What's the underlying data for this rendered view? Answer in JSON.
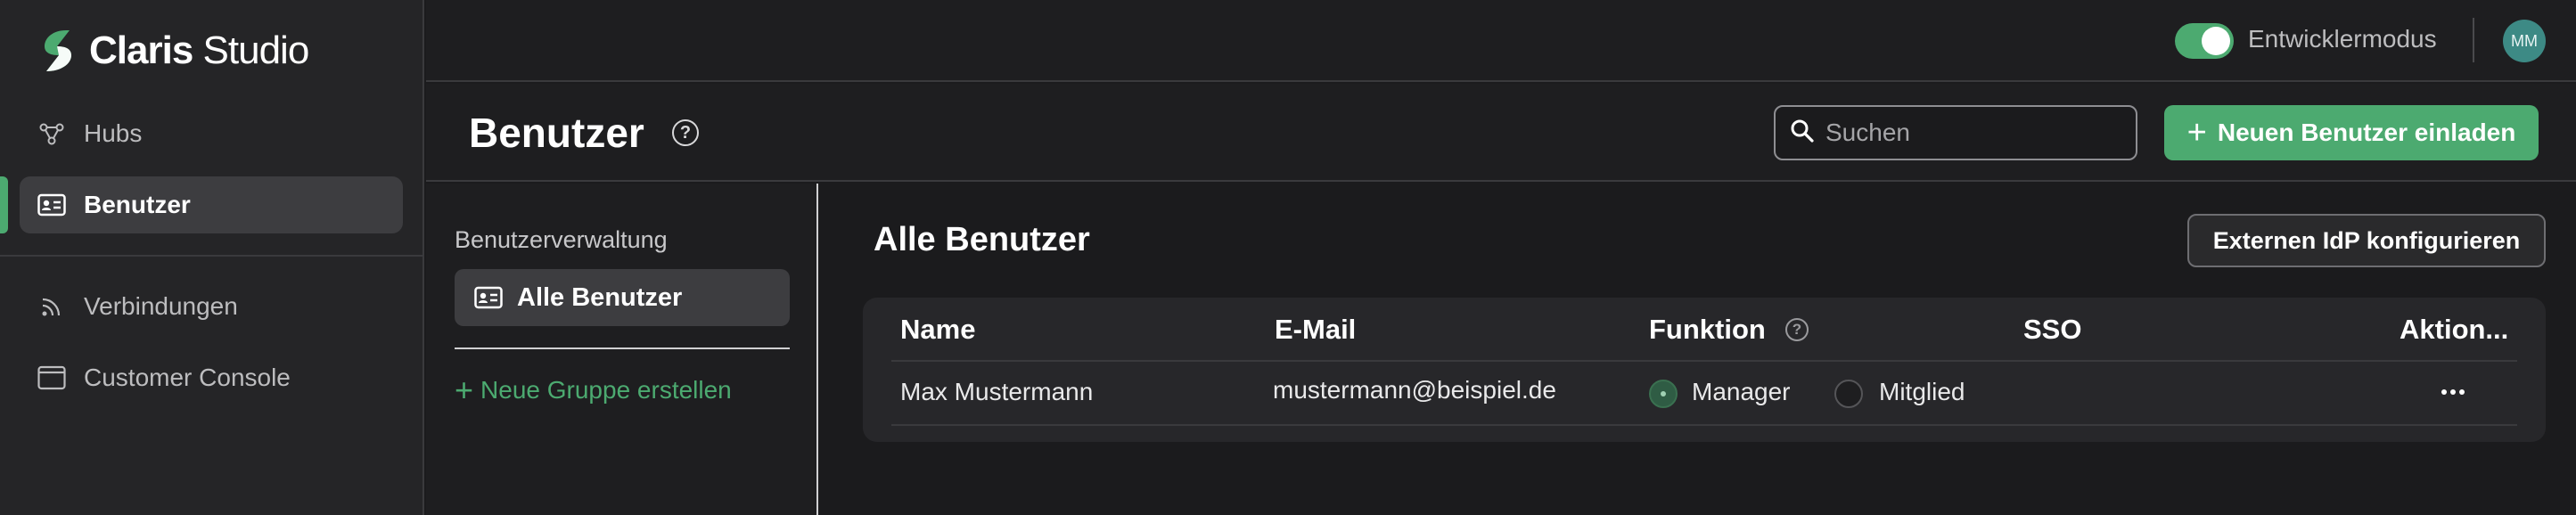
{
  "app": {
    "logo_word1": "Claris",
    "logo_word2": "Studio",
    "brand_color": "#4caa70"
  },
  "sidebar": {
    "items": [
      {
        "label": "Hubs",
        "icon": "hub-icon"
      },
      {
        "label": "Benutzer",
        "icon": "id-card-icon",
        "active": true
      },
      {
        "label": "Verbindungen",
        "icon": "rss-icon"
      },
      {
        "label": "Customer Console",
        "icon": "window-icon"
      }
    ]
  },
  "topbar": {
    "dev_mode_label": "Entwicklermodus",
    "dev_mode_on": true,
    "avatar_initials": "MM",
    "avatar_color": "#3d8a85"
  },
  "header": {
    "title": "Benutzer",
    "help": "?",
    "search_placeholder": "Suchen",
    "invite_label": "Neuen Benutzer einladen"
  },
  "subsidebar": {
    "heading": "Benutzerverwaltung",
    "item": "Alle Benutzer",
    "new_group": "Neue Gruppe erstellen"
  },
  "main": {
    "title": "Alle Benutzer",
    "idp_button": "Externen IdP konfigurieren",
    "columns": [
      "Name",
      "E-Mail",
      "Funktion",
      "SSO",
      "Aktion..."
    ],
    "function_help": "?",
    "rows": [
      {
        "name": "Max Mustermann",
        "email": "mustermann@beispiel.de",
        "roles": [
          {
            "label": "Manager",
            "selected": true
          },
          {
            "label": "Mitglied",
            "selected": false
          }
        ],
        "sso": ""
      }
    ]
  }
}
